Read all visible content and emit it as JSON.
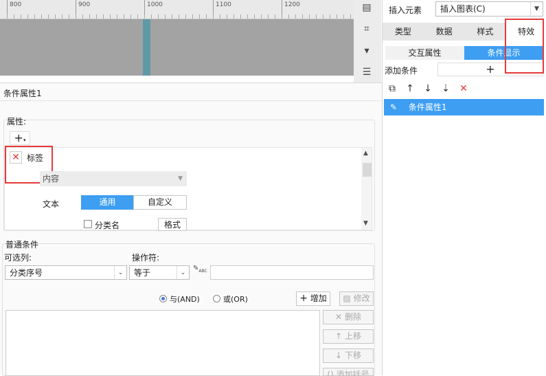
{
  "ruler": {
    "ticks": [
      "800",
      "900",
      "1000",
      "1100",
      "1200"
    ]
  },
  "right_panel": {
    "insert_element_label": "插入元素",
    "insert_select_value": "插入图表(C)",
    "tabs": [
      "类型",
      "数据",
      "样式",
      "特效"
    ],
    "segments": [
      "交互属性",
      "条件显示"
    ],
    "add_condition_label": "添加条件",
    "add_button": "+",
    "list_items": [
      "条件属性1"
    ]
  },
  "main": {
    "title": "条件属性1",
    "attr_section_label": "属性:",
    "plus": "+",
    "tag_label": "标签",
    "content_select_value": "内容",
    "text_label": "文本",
    "text_options": [
      "通用",
      "自定义"
    ],
    "category_checkbox_label": "分类名",
    "format_button": "格式",
    "normal_condition_label": "普通条件",
    "column_label": "可选列:",
    "operator_label": "操作符:",
    "column_value": "分类序号",
    "operator_value": "等于",
    "value_input": "",
    "and_label": "与(AND)",
    "or_label": "或(OR)",
    "add_btn": "增加",
    "modify_btn": "修改",
    "delete_btn": "删除",
    "up_btn": "上移",
    "down_btn": "下移",
    "bracket_btn": "添加括号"
  },
  "colors": {
    "accent": "#3d9ef2",
    "highlight_box": "#e53a3a"
  }
}
